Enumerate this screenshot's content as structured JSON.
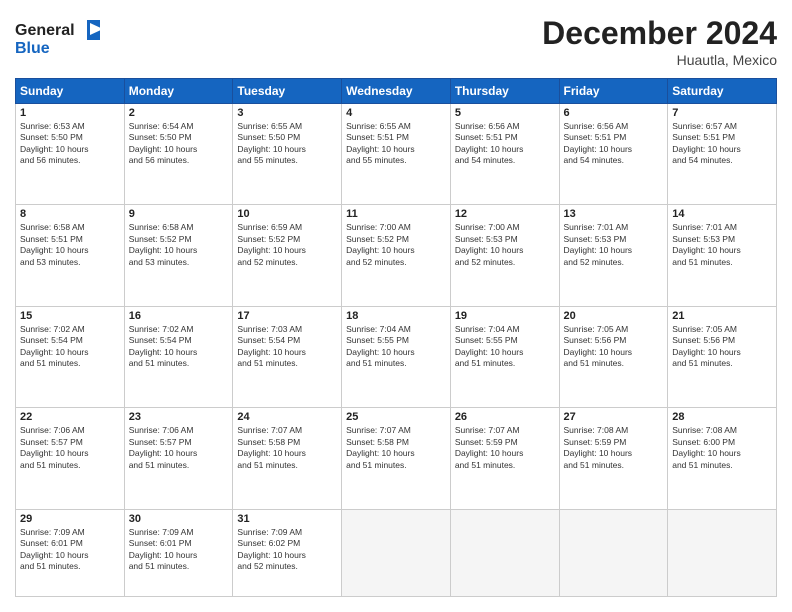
{
  "header": {
    "logo_general": "General",
    "logo_blue": "Blue",
    "month": "December 2024",
    "location": "Huautla, Mexico"
  },
  "weekdays": [
    "Sunday",
    "Monday",
    "Tuesday",
    "Wednesday",
    "Thursday",
    "Friday",
    "Saturday"
  ],
  "weeks": [
    [
      {
        "day": "1",
        "lines": [
          "Sunrise: 6:53 AM",
          "Sunset: 5:50 PM",
          "Daylight: 10 hours",
          "and 56 minutes."
        ]
      },
      {
        "day": "2",
        "lines": [
          "Sunrise: 6:54 AM",
          "Sunset: 5:50 PM",
          "Daylight: 10 hours",
          "and 56 minutes."
        ]
      },
      {
        "day": "3",
        "lines": [
          "Sunrise: 6:55 AM",
          "Sunset: 5:50 PM",
          "Daylight: 10 hours",
          "and 55 minutes."
        ]
      },
      {
        "day": "4",
        "lines": [
          "Sunrise: 6:55 AM",
          "Sunset: 5:51 PM",
          "Daylight: 10 hours",
          "and 55 minutes."
        ]
      },
      {
        "day": "5",
        "lines": [
          "Sunrise: 6:56 AM",
          "Sunset: 5:51 PM",
          "Daylight: 10 hours",
          "and 54 minutes."
        ]
      },
      {
        "day": "6",
        "lines": [
          "Sunrise: 6:56 AM",
          "Sunset: 5:51 PM",
          "Daylight: 10 hours",
          "and 54 minutes."
        ]
      },
      {
        "day": "7",
        "lines": [
          "Sunrise: 6:57 AM",
          "Sunset: 5:51 PM",
          "Daylight: 10 hours",
          "and 54 minutes."
        ]
      }
    ],
    [
      {
        "day": "8",
        "lines": [
          "Sunrise: 6:58 AM",
          "Sunset: 5:51 PM",
          "Daylight: 10 hours",
          "and 53 minutes."
        ]
      },
      {
        "day": "9",
        "lines": [
          "Sunrise: 6:58 AM",
          "Sunset: 5:52 PM",
          "Daylight: 10 hours",
          "and 53 minutes."
        ]
      },
      {
        "day": "10",
        "lines": [
          "Sunrise: 6:59 AM",
          "Sunset: 5:52 PM",
          "Daylight: 10 hours",
          "and 52 minutes."
        ]
      },
      {
        "day": "11",
        "lines": [
          "Sunrise: 7:00 AM",
          "Sunset: 5:52 PM",
          "Daylight: 10 hours",
          "and 52 minutes."
        ]
      },
      {
        "day": "12",
        "lines": [
          "Sunrise: 7:00 AM",
          "Sunset: 5:53 PM",
          "Daylight: 10 hours",
          "and 52 minutes."
        ]
      },
      {
        "day": "13",
        "lines": [
          "Sunrise: 7:01 AM",
          "Sunset: 5:53 PM",
          "Daylight: 10 hours",
          "and 52 minutes."
        ]
      },
      {
        "day": "14",
        "lines": [
          "Sunrise: 7:01 AM",
          "Sunset: 5:53 PM",
          "Daylight: 10 hours",
          "and 51 minutes."
        ]
      }
    ],
    [
      {
        "day": "15",
        "lines": [
          "Sunrise: 7:02 AM",
          "Sunset: 5:54 PM",
          "Daylight: 10 hours",
          "and 51 minutes."
        ]
      },
      {
        "day": "16",
        "lines": [
          "Sunrise: 7:02 AM",
          "Sunset: 5:54 PM",
          "Daylight: 10 hours",
          "and 51 minutes."
        ]
      },
      {
        "day": "17",
        "lines": [
          "Sunrise: 7:03 AM",
          "Sunset: 5:54 PM",
          "Daylight: 10 hours",
          "and 51 minutes."
        ]
      },
      {
        "day": "18",
        "lines": [
          "Sunrise: 7:04 AM",
          "Sunset: 5:55 PM",
          "Daylight: 10 hours",
          "and 51 minutes."
        ]
      },
      {
        "day": "19",
        "lines": [
          "Sunrise: 7:04 AM",
          "Sunset: 5:55 PM",
          "Daylight: 10 hours",
          "and 51 minutes."
        ]
      },
      {
        "day": "20",
        "lines": [
          "Sunrise: 7:05 AM",
          "Sunset: 5:56 PM",
          "Daylight: 10 hours",
          "and 51 minutes."
        ]
      },
      {
        "day": "21",
        "lines": [
          "Sunrise: 7:05 AM",
          "Sunset: 5:56 PM",
          "Daylight: 10 hours",
          "and 51 minutes."
        ]
      }
    ],
    [
      {
        "day": "22",
        "lines": [
          "Sunrise: 7:06 AM",
          "Sunset: 5:57 PM",
          "Daylight: 10 hours",
          "and 51 minutes."
        ]
      },
      {
        "day": "23",
        "lines": [
          "Sunrise: 7:06 AM",
          "Sunset: 5:57 PM",
          "Daylight: 10 hours",
          "and 51 minutes."
        ]
      },
      {
        "day": "24",
        "lines": [
          "Sunrise: 7:07 AM",
          "Sunset: 5:58 PM",
          "Daylight: 10 hours",
          "and 51 minutes."
        ]
      },
      {
        "day": "25",
        "lines": [
          "Sunrise: 7:07 AM",
          "Sunset: 5:58 PM",
          "Daylight: 10 hours",
          "and 51 minutes."
        ]
      },
      {
        "day": "26",
        "lines": [
          "Sunrise: 7:07 AM",
          "Sunset: 5:59 PM",
          "Daylight: 10 hours",
          "and 51 minutes."
        ]
      },
      {
        "day": "27",
        "lines": [
          "Sunrise: 7:08 AM",
          "Sunset: 5:59 PM",
          "Daylight: 10 hours",
          "and 51 minutes."
        ]
      },
      {
        "day": "28",
        "lines": [
          "Sunrise: 7:08 AM",
          "Sunset: 6:00 PM",
          "Daylight: 10 hours",
          "and 51 minutes."
        ]
      }
    ],
    [
      {
        "day": "29",
        "lines": [
          "Sunrise: 7:09 AM",
          "Sunset: 6:01 PM",
          "Daylight: 10 hours",
          "and 51 minutes."
        ]
      },
      {
        "day": "30",
        "lines": [
          "Sunrise: 7:09 AM",
          "Sunset: 6:01 PM",
          "Daylight: 10 hours",
          "and 51 minutes."
        ]
      },
      {
        "day": "31",
        "lines": [
          "Sunrise: 7:09 AM",
          "Sunset: 6:02 PM",
          "Daylight: 10 hours",
          "and 52 minutes."
        ]
      },
      {
        "day": "",
        "lines": []
      },
      {
        "day": "",
        "lines": []
      },
      {
        "day": "",
        "lines": []
      },
      {
        "day": "",
        "lines": []
      }
    ]
  ]
}
